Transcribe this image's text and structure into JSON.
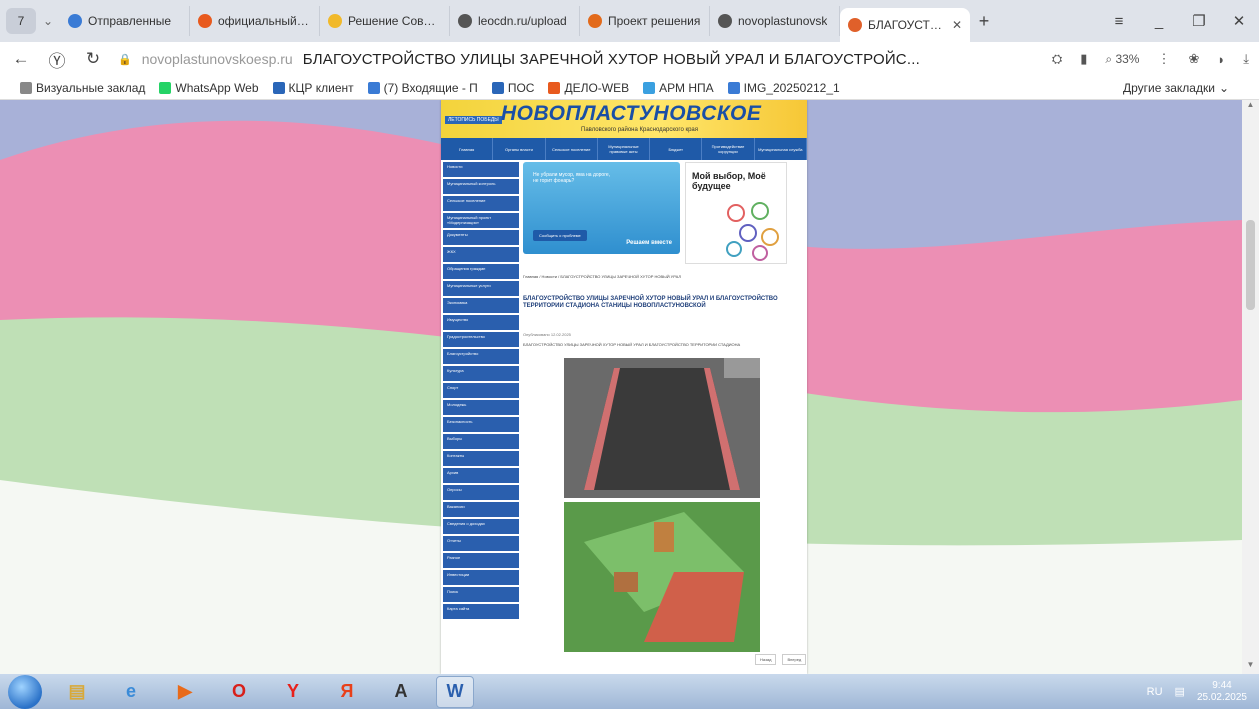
{
  "browser": {
    "tab_count": "7",
    "tabs": [
      {
        "label": "Отправленные",
        "color": "#3a7bd5"
      },
      {
        "label": "официальный са",
        "color": "#e85a1e"
      },
      {
        "label": "Решение Совета",
        "color": "#f1b92a"
      },
      {
        "label": "leocdn.ru/upload",
        "color": "#555555"
      },
      {
        "label": "Проект решения",
        "color": "#e26a1b"
      },
      {
        "label": "novoplastunovsk",
        "color": "#555555"
      },
      {
        "label": "БЛАГОУСТРО",
        "color": "#e0602a",
        "active": true
      }
    ],
    "new_tab": "+",
    "window_controls": [
      "≡",
      "_",
      "❐",
      "✕"
    ]
  },
  "address": {
    "host": "novoplastunovskoesp.ru",
    "title": "БЛАГОУСТРОЙСТВО УЛИЦЫ ЗАРЕЧНОЙ ХУТОР НОВЫЙ УРАЛ И БЛАГОУСТРОЙС...",
    "zoom": "33%"
  },
  "bookmarks": [
    {
      "label": "Визуальные заклад",
      "color": "#888888"
    },
    {
      "label": "WhatsApp Web",
      "color": "#25d366"
    },
    {
      "label": "КЦР клиент",
      "color": "#2a66b8"
    },
    {
      "label": "(7) Входящие - П",
      "color": "#3a7bd5"
    },
    {
      "label": "ПОС",
      "color": "#2a66b8"
    },
    {
      "label": "ДЕЛО-WEB",
      "color": "#e85a1e"
    },
    {
      "label": "АРМ НПА",
      "color": "#3aa0e0"
    },
    {
      "label": "IMG_20250212_1",
      "color": "#3a7bd5"
    }
  ],
  "bookmarks_other": "Другие закладки",
  "site": {
    "badge": "ЛЕТОПИСЬ ПОБЕДЫ",
    "logo": "НОВОПЛАСТУНОВСКОЕ",
    "subtitle": "Павловского района Краснодарского края",
    "nav": [
      "Главная",
      "Органы власти",
      "Сельское поселение",
      "Муниципальные правовые акты",
      "Бюджет",
      "Противодействие коррупции",
      "Муниципальная служба"
    ],
    "sidebar": [
      "Новости",
      "Муниципальный контроль",
      "Сельское поселение",
      "Муниципальный проект «Модернизация»",
      "Документы",
      "ЖКХ",
      "Обращения граждан",
      "Муниципальные услуги",
      "Экономика",
      "Имущество",
      "Градостроительство",
      "Благоустройство",
      "Культура",
      "Спорт",
      "Молодежь",
      "Безопасность",
      "Выборы",
      "Контакты",
      "Архив",
      "Опросы",
      "Вакансии",
      "Сведения о доходах",
      "Отчеты",
      "Разное",
      "Инвестиции",
      "Поиск",
      "Карта сайта"
    ],
    "promo1_text": "Не убрали мусор, яма на дороге, не горит фонарь?",
    "promo1_button": "Сообщить о проблеме",
    "promo1_brand": "Решаем вместе",
    "promo2_text": "Мой выбор, Моё будущее",
    "breadcrumbs": "Главная / Новости / БЛАГОУСТРОЙСТВО УЛИЦЫ ЗАРЕЧНОЙ ХУТОР НОВЫЙ УРАЛ",
    "article_title": "БЛАГОУСТРОЙСТВО УЛИЦЫ ЗАРЕЧНОЙ ХУТОР НОВЫЙ УРАЛ И БЛАГОУСТРОЙСТВО ТЕРРИТОРИИ СТАДИОНА СТАНИЦЫ НОВОПЛАСТУНОВСКОЙ",
    "meta": "Опубликовано 12.02.2025",
    "lead": "БЛАГОУСТРОЙСТВО УЛИЦЫ ЗАРЕЧНОЙ ХУТОР НОВЫЙ УРАЛ И БЛАГОУСТРОЙСТВО ТЕРРИТОРИИ СТАДИОНА",
    "pager": [
      "Назад",
      "Вперед"
    ]
  },
  "taskbar": {
    "apps": [
      {
        "name": "explorer",
        "glyph": "▤",
        "color": "#d8a93a"
      },
      {
        "name": "ie",
        "glyph": "e",
        "color": "#3a8bd8"
      },
      {
        "name": "media",
        "glyph": "▶",
        "color": "#e86a1a"
      },
      {
        "name": "opera",
        "glyph": "O",
        "color": "#d8201a"
      },
      {
        "name": "yandex-browser",
        "glyph": "Y",
        "color": "#e8201a"
      },
      {
        "name": "yandex",
        "glyph": "Я",
        "color": "#e8401a"
      },
      {
        "name": "app-a",
        "glyph": "A",
        "color": "#333333"
      },
      {
        "name": "word",
        "glyph": "W",
        "color": "#2a5fae",
        "active": true
      }
    ],
    "lang": "RU",
    "time": "9:44",
    "date": "25.02.2025"
  }
}
